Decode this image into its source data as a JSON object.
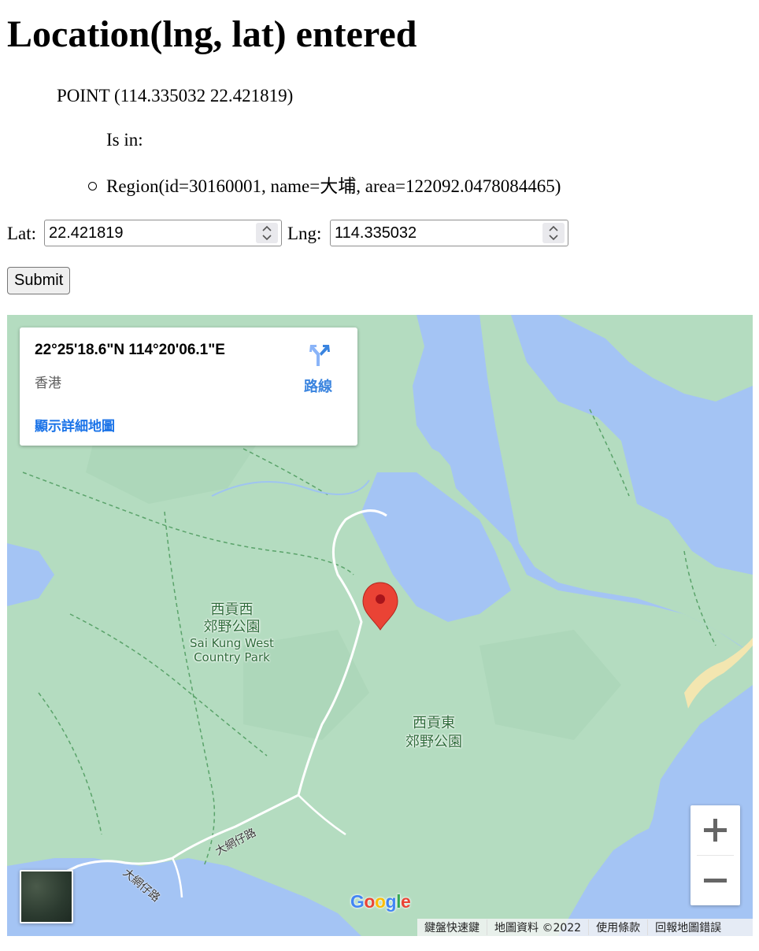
{
  "heading": "Location(lng, lat) entered",
  "point_text": "POINT (114.335032 22.421819)",
  "is_in_label": "Is in:",
  "regions": [
    {
      "text": "Region(id=30160001, name=大埔, area=122092.0478084465)"
    }
  ],
  "form": {
    "lat_label": "Lat:",
    "lat_value": "22.421819",
    "lng_label": "Lng:",
    "lng_value": "114.335032",
    "submit_label": "Submit"
  },
  "map": {
    "info_card": {
      "coordinates": "22°25'18.6\"N 114°20'06.1\"E",
      "place": "香港",
      "directions_label": "路線",
      "detail_link": "顯示詳細地圖"
    },
    "labels": {
      "park_west_zh_1": "西貢西",
      "park_west_zh_2": "郊野公園",
      "park_west_en_1": "Sai Kung West",
      "park_west_en_2": "Country Park",
      "park_east_zh_1": "西貢東",
      "park_east_zh_2": "郊野公園",
      "road_1": "大網仔路",
      "road_2": "大網仔路"
    },
    "attribution": {
      "keyboard": "鍵盤快速鍵",
      "map_data": "地圖資料 ©2022",
      "terms": "使用條款",
      "report": "回報地圖錯誤"
    },
    "colors": {
      "water": "#a4c4f4",
      "land": "#b4dcc0",
      "marker": "#ea4335"
    }
  }
}
